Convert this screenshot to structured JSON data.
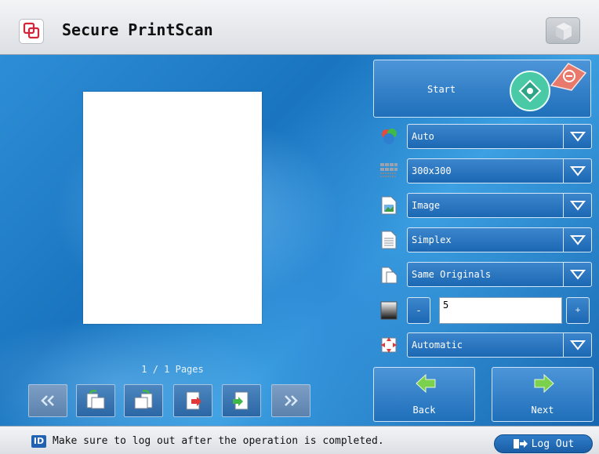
{
  "app": {
    "title": "Secure PrintScan"
  },
  "preview": {
    "pages_label": "1 / 1 Pages"
  },
  "start": {
    "label": "Start"
  },
  "settings": {
    "color_mode": "Auto",
    "resolution": "300x300",
    "original_type": "Image",
    "sides": "Simplex",
    "original_size": "Same Originals",
    "density": {
      "minus": "-",
      "plus": "+",
      "value": "5"
    },
    "orientation": "Automatic"
  },
  "nav": {
    "back_label": "Back",
    "next_label": "Next"
  },
  "footer": {
    "id_badge": "ID",
    "message": "Make sure to log out after the operation is completed.",
    "logout_label": "Log Out"
  },
  "colors": {
    "accent": "#1f6fba",
    "header_bg": "#e6e8eb",
    "start_green": "#49c9a6",
    "stop_red": "#e87a6b"
  }
}
